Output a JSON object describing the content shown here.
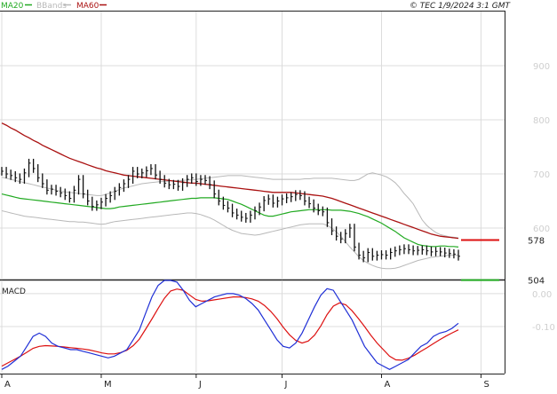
{
  "header": {
    "legend": [
      {
        "label": "MA20",
        "color": "#22aa22"
      },
      {
        "label": "BBands",
        "color": "#b8b8b8"
      },
      {
        "label": "MA60",
        "color": "#aa1111"
      }
    ],
    "copyright": "© TEC 1/9/2024 3:1 GMT"
  },
  "colors": {
    "ma20": "#22aa22",
    "bbands": "#b8b8b8",
    "ma60": "#aa1111",
    "macd": "#1f2fd6",
    "signal": "#dd1111",
    "price": "#111111",
    "grid": "#dcdcdc",
    "axis_text": "#cfcfcf"
  },
  "chart_data": [
    {
      "type": "line",
      "title": "",
      "xlabel": "",
      "ylabel": "",
      "ylim": [
        505,
        1000
      ],
      "yticks": [
        600,
        700,
        800,
        900
      ],
      "ytick_labels": [
        "600",
        "700",
        "800",
        "900"
      ],
      "grid": true,
      "legend": "top-left",
      "x_months": [
        {
          "label": "A",
          "index": 0
        },
        {
          "label": "M",
          "index": 22
        },
        {
          "label": "J",
          "index": 43
        },
        {
          "label": "J",
          "index": 62
        },
        {
          "label": "A",
          "index": 84
        },
        {
          "label": "S",
          "index": 106
        }
      ],
      "series": [
        {
          "name": "MA20",
          "values": [
            663,
            661,
            659,
            657,
            655,
            654,
            653,
            652,
            651,
            650,
            649,
            648,
            647,
            646,
            645,
            644,
            643,
            642,
            641,
            640,
            639,
            638,
            637,
            636,
            636,
            637,
            639,
            640,
            641,
            642,
            643,
            644,
            645,
            646,
            647,
            648,
            649,
            650,
            651,
            652,
            653,
            654,
            655,
            655,
            656,
            656,
            656,
            656,
            655,
            654,
            653,
            650,
            647,
            644,
            640,
            636,
            632,
            628,
            624,
            622,
            622,
            624,
            626,
            628,
            630,
            631,
            632,
            633,
            634,
            634,
            634,
            634,
            634,
            633,
            633,
            633,
            632,
            631,
            629,
            627,
            624,
            621,
            617,
            613,
            609,
            604,
            599,
            594,
            588,
            582,
            578,
            574,
            570,
            568,
            567,
            566,
            566,
            567,
            567,
            566,
            566,
            565
          ]
        },
        {
          "name": "MA60",
          "values": [
            794,
            790,
            785,
            781,
            776,
            771,
            767,
            762,
            758,
            753,
            749,
            745,
            741,
            737,
            733,
            729,
            726,
            723,
            720,
            717,
            714,
            711,
            709,
            706,
            704,
            702,
            700,
            698,
            697,
            696,
            695,
            694,
            693,
            692,
            691,
            690,
            689,
            688,
            687,
            686,
            685,
            684,
            683,
            683,
            682,
            681,
            680,
            679,
            678,
            677,
            676,
            675,
            674,
            673,
            672,
            671,
            670,
            669,
            668,
            667,
            666,
            666,
            666,
            666,
            666,
            665,
            664,
            663,
            662,
            661,
            660,
            659,
            657,
            655,
            652,
            649,
            646,
            643,
            640,
            637,
            634,
            631,
            628,
            625,
            622,
            619,
            616,
            613,
            610,
            607,
            604,
            601,
            598,
            595,
            592,
            589,
            587,
            585,
            584,
            583,
            582,
            581
          ]
        },
        {
          "name": "BBands upper",
          "values": [
            694,
            692,
            690,
            688,
            686,
            684,
            682,
            680,
            678,
            676,
            674,
            672,
            670,
            668,
            667,
            666,
            665,
            664,
            663,
            662,
            661,
            660,
            660,
            662,
            665,
            668,
            671,
            674,
            676,
            678,
            680,
            682,
            683,
            684,
            685,
            686,
            686,
            687,
            687,
            688,
            688,
            689,
            689,
            690,
            691,
            692,
            693,
            694,
            695,
            696,
            697,
            697,
            697,
            697,
            696,
            695,
            694,
            693,
            692,
            691,
            690,
            690,
            690,
            690,
            690,
            690,
            690,
            691,
            691,
            692,
            692,
            692,
            692,
            692,
            691,
            690,
            689,
            688,
            688,
            690,
            695,
            700,
            702,
            700,
            698,
            695,
            690,
            684,
            675,
            664,
            655,
            645,
            630,
            615,
            605,
            598,
            592,
            588,
            586,
            584,
            583,
            582
          ]
        },
        {
          "name": "BBands lower",
          "values": [
            632,
            630,
            628,
            626,
            624,
            622,
            621,
            620,
            619,
            618,
            617,
            616,
            615,
            614,
            613,
            612,
            612,
            611,
            611,
            610,
            609,
            608,
            607,
            608,
            610,
            612,
            613,
            614,
            615,
            616,
            617,
            618,
            619,
            620,
            621,
            622,
            623,
            624,
            625,
            626,
            627,
            628,
            628,
            627,
            625,
            622,
            619,
            615,
            610,
            605,
            600,
            596,
            593,
            590,
            589,
            588,
            587,
            588,
            590,
            592,
            594,
            596,
            598,
            600,
            602,
            604,
            606,
            607,
            608,
            608,
            608,
            608,
            605,
            600,
            593,
            585,
            575,
            565,
            556,
            547,
            540,
            535,
            531,
            528,
            526,
            525,
            525,
            526,
            528,
            531,
            534,
            537,
            540,
            542,
            544,
            546,
            547,
            548,
            549,
            550,
            550,
            550
          ]
        },
        {
          "name": "Price",
          "values": [
            705,
            700,
            697,
            693,
            690,
            702,
            720,
            710,
            693,
            682,
            670,
            672,
            668,
            665,
            660,
            655,
            670,
            690,
            663,
            650,
            640,
            643,
            648,
            655,
            660,
            668,
            675,
            682,
            690,
            705,
            700,
            702,
            706,
            710,
            698,
            690,
            683,
            680,
            681,
            677,
            684,
            690,
            693,
            686,
            690,
            688,
            680,
            663,
            650,
            642,
            637,
            628,
            624,
            620,
            618,
            624,
            632,
            639,
            651,
            654,
            646,
            650,
            654,
            656,
            658,
            662,
            660,
            650,
            645,
            637,
            632,
            630,
            610,
            595,
            585,
            580,
            590,
            600,
            565,
            550,
            545,
            555,
            548,
            550,
            551,
            550,
            555,
            558,
            560,
            562,
            560,
            558,
            559,
            560,
            558,
            556,
            557,
            556,
            554,
            553,
            552,
            548
          ]
        }
      ],
      "annotations": [
        {
          "label": "578",
          "value": 578,
          "color": "#dd1111"
        },
        {
          "label": "504",
          "value": 504,
          "color": "#22aa22"
        }
      ]
    },
    {
      "type": "line",
      "title": "MACD",
      "xlabel": "",
      "ylabel": "",
      "ylim": [
        -24,
        4
      ],
      "yticks": [
        0,
        -10
      ],
      "ytick_labels": [
        "0.00",
        "-0.10"
      ],
      "grid": true,
      "series": [
        {
          "name": "MACD",
          "values": [
            -23,
            -22,
            -20.5,
            -19,
            -16,
            -13,
            -12,
            -13,
            -15,
            -16,
            -16.5,
            -17,
            -17,
            -17.5,
            -18,
            -18.5,
            -19,
            -19.5,
            -19,
            -18,
            -17,
            -14,
            -11,
            -6,
            -1,
            2.5,
            4,
            4,
            3.5,
            1,
            -2,
            -4,
            -3,
            -2,
            -1,
            -0.5,
            0,
            0,
            -0.5,
            -1.5,
            -3,
            -5,
            -8,
            -11,
            -14,
            -16,
            -16.5,
            -15,
            -12,
            -8,
            -4,
            -0.5,
            1.5,
            1,
            -2,
            -5,
            -8,
            -12,
            -16,
            -18.5,
            -21,
            -22,
            -23,
            -22,
            -21,
            -20,
            -18,
            -16,
            -15,
            -13,
            -12,
            -11.5,
            -10.5,
            -9
          ]
        },
        {
          "name": "Signal",
          "values": [
            -22,
            -21,
            -20,
            -19,
            -17.8,
            -16.6,
            -16,
            -15.8,
            -15.9,
            -16,
            -16.2,
            -16.4,
            -16.6,
            -16.8,
            -17.1,
            -17.5,
            -18,
            -18.3,
            -18.3,
            -17.9,
            -17.2,
            -15.8,
            -13.8,
            -10.8,
            -7.7,
            -4.5,
            -1.4,
            0.8,
            1.4,
            1,
            -0.4,
            -1.8,
            -2.3,
            -2.2,
            -1.9,
            -1.6,
            -1.3,
            -1,
            -1,
            -1.2,
            -1.6,
            -2.3,
            -3.6,
            -5.4,
            -7.6,
            -10.2,
            -12.5,
            -14.2,
            -15,
            -14.4,
            -12.6,
            -9.8,
            -6.4,
            -3.8,
            -2.8,
            -3.4,
            -5.2,
            -7.5,
            -10,
            -12.6,
            -15,
            -17,
            -19,
            -20.1,
            -20.2,
            -19.6,
            -18.7,
            -17.5,
            -16.4,
            -15.2,
            -14,
            -12.9,
            -11.9,
            -11
          ]
        }
      ]
    }
  ]
}
